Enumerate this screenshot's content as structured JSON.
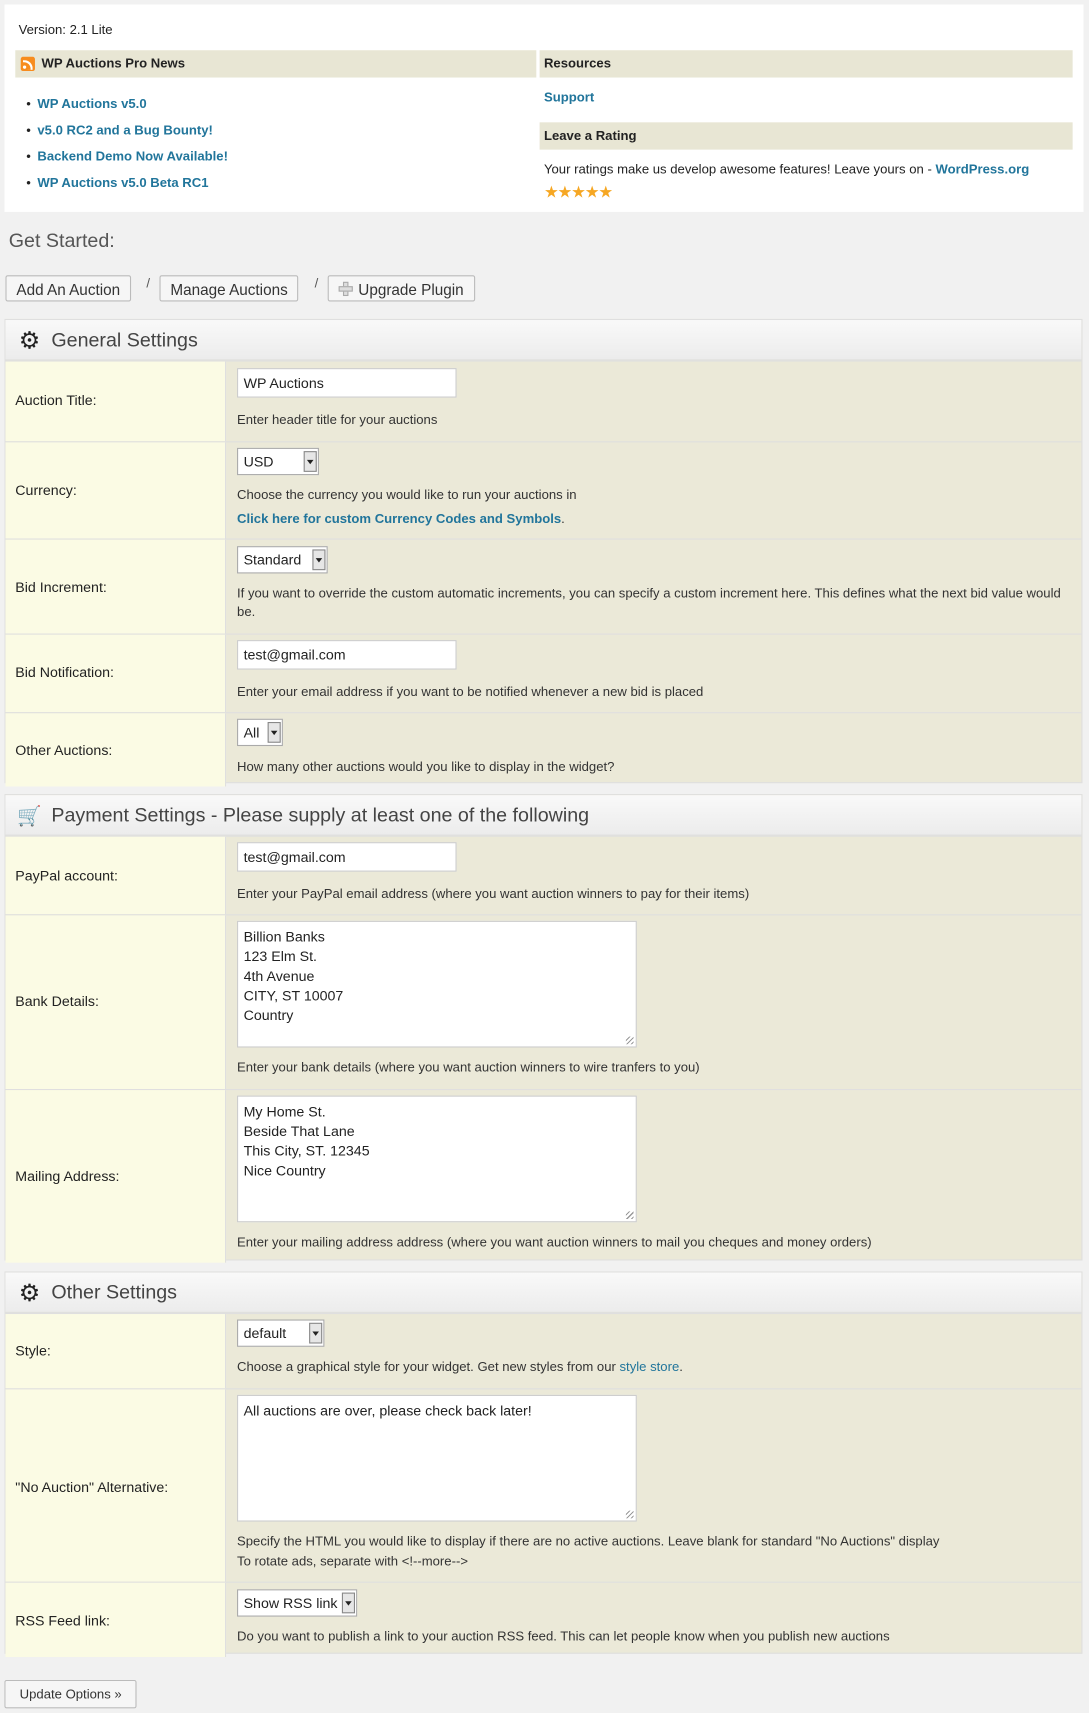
{
  "header": {
    "version": "Version: 2.1 Lite"
  },
  "news": {
    "title": "WP Auctions Pro News",
    "items": [
      "WP Auctions v5.0",
      "v5.0 RC2 and a Bug Bounty!",
      "Backend Demo Now Available!",
      "WP Auctions v5.0 Beta RC1"
    ]
  },
  "resources": {
    "title": "Resources",
    "support": "Support"
  },
  "rating": {
    "title": "Leave a Rating",
    "text": "Your ratings make us develop awesome features! Leave yours on - ",
    "link": "WordPress.org",
    "stars": "★★★★★"
  },
  "get_started": {
    "title": "Get Started:",
    "buttons": [
      "Add An Auction",
      "Manage Auctions",
      "Upgrade Plugin"
    ],
    "separator": "/"
  },
  "general": {
    "title": "General Settings",
    "auction_title": {
      "label": "Auction Title:",
      "value": "WP Auctions",
      "help": "Enter header title for your auctions"
    },
    "currency": {
      "label": "Currency:",
      "value": "USD",
      "help": "Choose the currency you would like to run your auctions in",
      "link": "Click here for custom Currency Codes and Symbols",
      "link_suffix": "."
    },
    "bid_increment": {
      "label": "Bid Increment:",
      "value": "Standard",
      "help": "If you want to override the custom automatic increments, you can specify a custom increment here. This defines what the next bid value would be."
    },
    "bid_notification": {
      "label": "Bid Notification:",
      "value": "test@gmail.com",
      "help": "Enter your email address if you want to be notified whenever a new bid is placed"
    },
    "other_auctions": {
      "label": "Other Auctions:",
      "value": "All",
      "help": "How many other auctions would you like to display in the widget?"
    }
  },
  "payment": {
    "title": "Payment Settings - Please supply at least one of the following",
    "paypal": {
      "label": "PayPal account:",
      "value": "test@gmail.com",
      "help": "Enter your PayPal email address (where you want auction winners to pay for their items)"
    },
    "bank": {
      "label": "Bank Details:",
      "value": "Billion Banks\n123 Elm St.\n4th Avenue\nCITY, ST 10007\nCountry",
      "help": "Enter your bank details (where you want auction winners to wire tranfers to you)"
    },
    "mailing": {
      "label": "Mailing Address:",
      "value": "My Home St.\nBeside That Lane\nThis City, ST. 12345\nNice Country",
      "help": "Enter your mailing address address (where you want auction winners to mail you cheques and money orders)"
    }
  },
  "other": {
    "title": "Other Settings",
    "style": {
      "label": "Style:",
      "value": "default",
      "help": "Choose a graphical style for your widget. Get new styles from our ",
      "link": "style store",
      "link_suffix": "."
    },
    "no_auction": {
      "label": "\"No Auction\" Alternative:",
      "value": "All auctions are over, please check back later!",
      "help1": "Specify the HTML you would like to display if there are no active auctions. Leave blank for standard \"No Auctions\" display",
      "help2": "To rotate ads, separate with <!--more-->"
    },
    "rss": {
      "label": "RSS Feed link:",
      "value": "Show RSS link",
      "help": "Do you want to publish a link to your auction RSS feed. This can let people know when you publish new auctions"
    }
  },
  "footer": {
    "update": "Update Options »"
  }
}
